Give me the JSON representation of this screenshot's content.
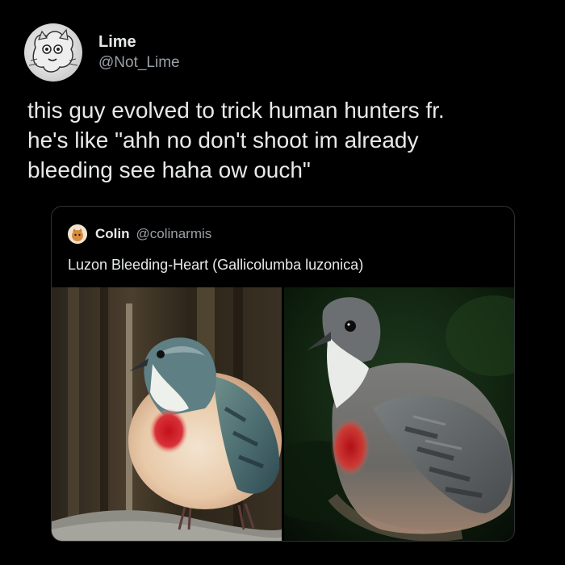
{
  "author": {
    "display_name": "Lime",
    "handle": "@Not_Lime"
  },
  "tweet": {
    "text": "this guy evolved to trick human hunters fr.\nhe's like \"ahh no don't shoot im already\nbleeding see haha ow ouch\""
  },
  "quoted_tweet": {
    "display_name": "Colin",
    "handle": "@colinarmis",
    "text": "Luzon Bleeding-Heart (Gallicolumba luzonica)"
  },
  "icons": {
    "author_avatar": "cartoon-cat-avatar-icon",
    "quoted_avatar": "cartoon-avatar-icon"
  }
}
